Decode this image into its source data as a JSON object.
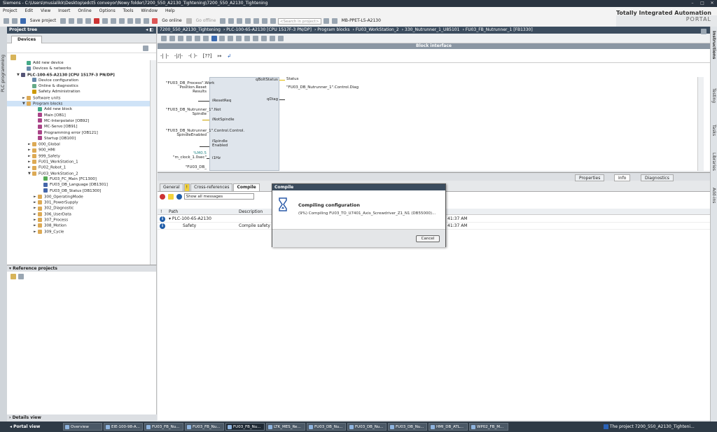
{
  "window": {
    "title": "Siemens - C:\\Users\\musialikk\\Desktop\\edct5 conveyor\\Nowy folder\\7200_550_A2130_Tightening\\7200_550_A2130_Tightening",
    "brand_line1": "Totally Integrated Automation",
    "brand_line2": "PORTAL"
  },
  "menu": [
    "Project",
    "Edit",
    "View",
    "Insert",
    "Online",
    "Options",
    "Tools",
    "Window",
    "Help"
  ],
  "toolbar": {
    "save_label": "Save project",
    "go_online": "Go online",
    "go_offline": "Go offline",
    "search_placeholder": "<Search in project>",
    "device_label": "MB-PPET-L5-A2130"
  },
  "left_vtab": "PLC programming",
  "project_tree": {
    "title": "Project tree",
    "tab": "Devices",
    "items": [
      {
        "label": "Add new device",
        "indent": 1,
        "color": "#4a8"
      },
      {
        "label": "Devices & networks",
        "indent": 1,
        "color": "#68a"
      },
      {
        "label": "PLC-100-65-A2130 [CPU 1517F-3 PN/DP]",
        "indent": 0,
        "color": "#557",
        "bold": true,
        "arrow": "▼"
      },
      {
        "label": "Device configuration",
        "indent": 2,
        "color": "#68a"
      },
      {
        "label": "Online & diagnostics",
        "indent": 2,
        "color": "#6a8"
      },
      {
        "label": "Safety Administration",
        "indent": 2,
        "color": "#c90"
      },
      {
        "label": "Software units",
        "indent": 1,
        "color": "#da5",
        "arrow": "►"
      },
      {
        "label": "Program blocks",
        "indent": 1,
        "color": "#da5",
        "arrow": "▼",
        "sel": true
      },
      {
        "label": "Add new block",
        "indent": 3,
        "color": "#4a8"
      },
      {
        "label": "Main [OB1]",
        "indent": 3,
        "color": "#a48"
      },
      {
        "label": "MC-Interpolator [OB92]",
        "indent": 3,
        "color": "#a48"
      },
      {
        "label": "MC-Servo [OB91]",
        "indent": 3,
        "color": "#a48"
      },
      {
        "label": "Programming error [OB121]",
        "indent": 3,
        "color": "#a48"
      },
      {
        "label": "Startup [OB100]",
        "indent": 3,
        "color": "#a48"
      },
      {
        "label": "000_Global",
        "indent": 2,
        "color": "#da5",
        "arrow": "►"
      },
      {
        "label": "900_HMI",
        "indent": 2,
        "color": "#da5",
        "arrow": "►"
      },
      {
        "label": "999_Safety",
        "indent": 2,
        "color": "#da5",
        "arrow": "►"
      },
      {
        "label": "FU01_WorkStation_1",
        "indent": 2,
        "color": "#da5",
        "arrow": "►"
      },
      {
        "label": "FU02_Robot_1",
        "indent": 2,
        "color": "#da5",
        "arrow": "►"
      },
      {
        "label": "FU03_WorkStation_2",
        "indent": 2,
        "color": "#da5",
        "arrow": "▼"
      },
      {
        "label": "FU03_FC_Main [FC1300]",
        "indent": 4,
        "color": "#5a5"
      },
      {
        "label": "FU03_DB_Language [DB1301]",
        "indent": 4,
        "color": "#46a"
      },
      {
        "label": "FU03_DB_Status [DB1300]",
        "indent": 4,
        "color": "#46a"
      },
      {
        "label": "300_OperatingMode",
        "indent": 3,
        "color": "#da5",
        "arrow": "►"
      },
      {
        "label": "301_PowerSupply",
        "indent": 3,
        "color": "#da5",
        "arrow": "►"
      },
      {
        "label": "302_Diagnostic",
        "indent": 3,
        "color": "#da5",
        "arrow": "►"
      },
      {
        "label": "306_UserData",
        "indent": 3,
        "color": "#da5",
        "arrow": "►"
      },
      {
        "label": "307_Process",
        "indent": 3,
        "color": "#da5",
        "arrow": "►"
      },
      {
        "label": "308_Motion",
        "indent": 3,
        "color": "#da5",
        "arrow": "►"
      },
      {
        "label": "309_Cycle",
        "indent": 3,
        "color": "#da5",
        "arrow": "►"
      }
    ]
  },
  "reference_projects": {
    "title": "Reference projects"
  },
  "details_view": {
    "title": "Details view"
  },
  "breadcrumb": [
    "7200_550_A2130_Tightening",
    "PLC-100-65-A2130 [CPU 1517F-3 PN/DP]",
    "Program blocks",
    "FU03_WorkStation_2",
    "330_Nutrunner_1_U85101",
    "FU03_FB_Nutrunner_1 [FB1330]"
  ],
  "editor": {
    "block_interface": "Block interface",
    "inputs": [
      {
        "param": "iResetReq",
        "operand": "\"FU03_DB_Process\".Work Position.Reset Results"
      },
      {
        "param": "iNotSpindle",
        "operand": "\"FU03_DB_Nutrunner_1\".Not Spindle"
      },
      {
        "param": "iSpindle Enabled",
        "operand": "\"FU03_DB_Nutrunner_1\".Control.Control. SpindleEnabled"
      },
      {
        "param": "i1Hz",
        "operand_addr": "%M0.5",
        "operand": "\"m_clock_1.0sec\""
      },
      {
        "param": "",
        "operand": "\"FU03_DB_"
      }
    ],
    "outputs": [
      {
        "param": "qBoltStatus",
        "operand": "Status"
      },
      {
        "param": "qDiag",
        "operand": "\"FU03_DB_Nutrunner_1\".Control.Diag"
      }
    ]
  },
  "inspector": {
    "props": "Properties",
    "info": "Info",
    "diag": "Diagnostics",
    "tabs": [
      "General",
      "Cross-references",
      "Compile"
    ],
    "filter": "Show all messages",
    "columns": {
      "path": "Path",
      "desc": "Description"
    },
    "rows": [
      {
        "path": "PLC-100-65-A2130",
        "desc": "",
        "time": "41:37 AM"
      },
      {
        "path": "Safety",
        "desc": "Compile safety pr...",
        "time": "41:37 AM"
      }
    ]
  },
  "dialog": {
    "title": "Compile",
    "heading": "Compiling configuration",
    "status": "(9%) Compiling FU03_TO_U7401_Axis_Screwdriver_Z1_N1 (DB55000)...",
    "cancel": "Cancel",
    "progress": 9
  },
  "right_tabs": [
    "Instructions",
    "Testing",
    "Tasks",
    "Libraries",
    "Add-ins"
  ],
  "taskbar": {
    "portal_view": "Portal view",
    "items": [
      {
        "label": "Overview",
        "active": false
      },
      {
        "label": "EIE-100-98-A...",
        "active": false
      },
      {
        "label": "FU03_FB_Nu...",
        "active": false
      },
      {
        "label": "FU03_FB_Nu...",
        "active": false
      },
      {
        "label": "FU03_FB_Nu...",
        "active": true
      },
      {
        "label": "LTK_MES_Re...",
        "active": false
      },
      {
        "label": "FU03_DB_Nu...",
        "active": false
      },
      {
        "label": "FU03_DB_Nu...",
        "active": false
      },
      {
        "label": "FU03_DB_Nu...",
        "active": false
      },
      {
        "label": "HMI_DB_ATL...",
        "active": false
      },
      {
        "label": "WP02_FB_M...",
        "active": false
      }
    ],
    "status": "The project 7200_550_A2130_Tighteni..."
  }
}
